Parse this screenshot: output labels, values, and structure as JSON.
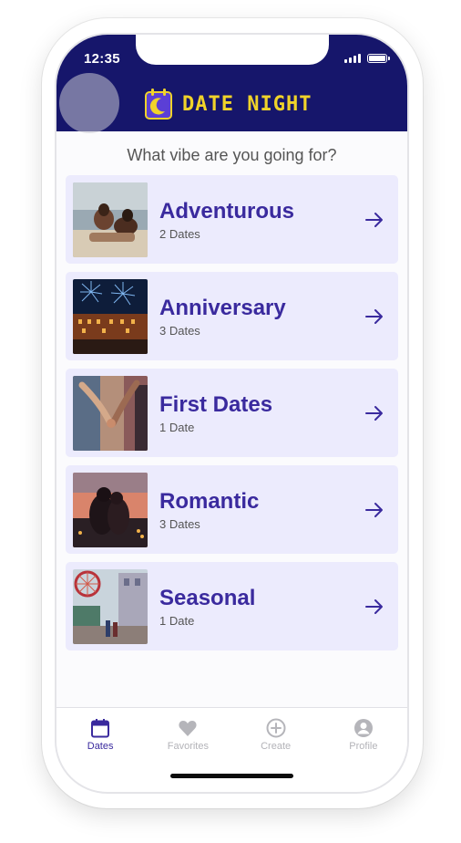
{
  "status_bar": {
    "time": "12:35"
  },
  "header": {
    "brand_title": "DATE NIGHT",
    "brand_icon": "calendar-moon-icon",
    "color": "#16166b",
    "accent": "#f0d32a"
  },
  "prompt": "What vibe are you going for?",
  "categories": [
    {
      "title": "Adventurous",
      "count": "2 Dates",
      "image": "beach-couple-photo"
    },
    {
      "title": "Anniversary",
      "count": "3 Dates",
      "image": "fireworks-city-photo"
    },
    {
      "title": "First Dates",
      "count": "1 Date",
      "image": "holding-hands-photo"
    },
    {
      "title": "Romantic",
      "count": "3 Dates",
      "image": "couple-sunset-photo"
    },
    {
      "title": "Seasonal",
      "count": "1 Date",
      "image": "carnival-ferris-wheel-photo"
    }
  ],
  "tabs": [
    {
      "label": "Dates",
      "icon": "calendar-icon",
      "active": true
    },
    {
      "label": "Favorites",
      "icon": "heart-icon",
      "active": false
    },
    {
      "label": "Create",
      "icon": "plus-circle-icon",
      "active": false
    },
    {
      "label": "Profile",
      "icon": "user-circle-icon",
      "active": false
    }
  ],
  "colors": {
    "card_bg": "#ecebfd",
    "accent_text": "#3a2a9e"
  }
}
